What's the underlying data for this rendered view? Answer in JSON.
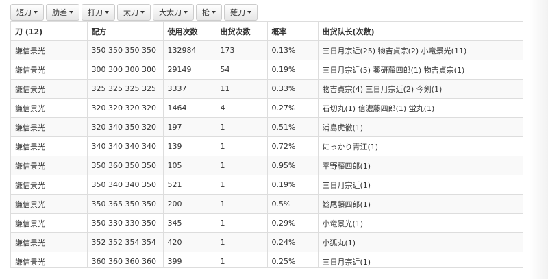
{
  "toolbar": {
    "buttons": [
      "短刀",
      "肋差",
      "打刀",
      "太刀",
      "大太刀",
      "枪",
      "薙刀"
    ]
  },
  "table": {
    "headers": [
      "刀 (12)",
      "配方",
      "使用次数",
      "出货次数",
      "概率",
      "出货队长(次数)"
    ],
    "rows": [
      [
        "謙信景光",
        "350 350 350 350",
        "132984",
        "173",
        "0.13%",
        "三日月宗近(25) 物吉貞宗(2) 小竜景光(11)"
      ],
      [
        "謙信景光",
        "300 300 300 300",
        "29149",
        "54",
        "0.19%",
        "三日月宗近(5) 薬研藤四郎(1) 物吉貞宗(1)"
      ],
      [
        "謙信景光",
        "325 325 325 325",
        "3337",
        "11",
        "0.33%",
        "物吉貞宗(4) 三日月宗近(2) 今剣(1)"
      ],
      [
        "謙信景光",
        "320 320 320 320",
        "1464",
        "4",
        "0.27%",
        "石切丸(1) 信濃藤四郎(1) 蛍丸(1)"
      ],
      [
        "謙信景光",
        "320 340 350 320",
        "197",
        "1",
        "0.51%",
        "浦島虎徹(1)"
      ],
      [
        "謙信景光",
        "340 340 340 340",
        "139",
        "1",
        "0.72%",
        "にっかり青江(1)"
      ],
      [
        "謙信景光",
        "350 360 350 350",
        "105",
        "1",
        "0.95%",
        "平野藤四郎(1)"
      ],
      [
        "謙信景光",
        "350 340 340 350",
        "521",
        "1",
        "0.19%",
        "三日月宗近(1)"
      ],
      [
        "謙信景光",
        "350 365 350 350",
        "200",
        "1",
        "0.5%",
        "鯰尾藤四郎(1)"
      ],
      [
        "謙信景光",
        "350 330 330 350",
        "345",
        "1",
        "0.29%",
        "小竜景光(1)"
      ],
      [
        "謙信景光",
        "352 352 354 354",
        "420",
        "1",
        "0.24%",
        "小狐丸(1)"
      ],
      [
        "謙信景光",
        "360 360 360 360",
        "399",
        "1",
        "0.25%",
        "三日月宗近(1)"
      ]
    ]
  },
  "colors": {
    "border": "#dddddd",
    "stripe": "#f9f9f9",
    "text": "#333333"
  }
}
